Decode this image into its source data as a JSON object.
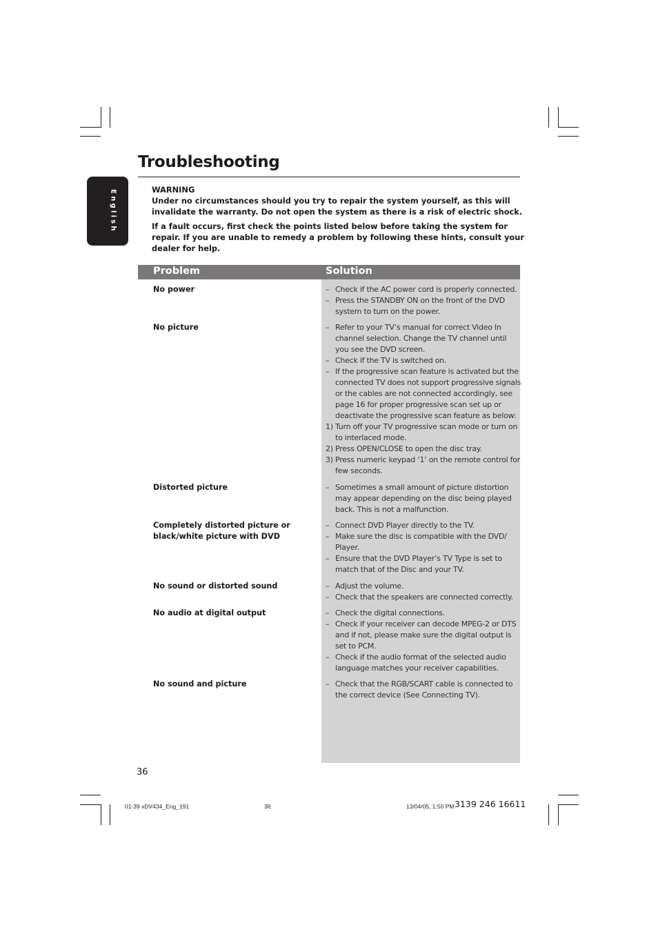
{
  "page": {
    "title": "Troubleshooting",
    "language_tab": "English",
    "warning": {
      "heading": "WARNING",
      "text": "Under no circumstances should you try to repair the system yourself, as this will invalidate the warranty.  Do not open the system as there is a risk of electric shock.",
      "advice": "If a fault occurs, first check the points listed below before taking the system for repair. If you are unable to remedy a problem by following these hints, consult your dealer for help."
    },
    "table": {
      "headers": {
        "problem": "Problem",
        "solution": "Solution"
      },
      "rows": [
        {
          "problem": "No power",
          "solutions": [
            {
              "marker": "–",
              "text": "Check if the AC power cord is properly connected."
            },
            {
              "marker": "–",
              "text": "Press the STANDBY ON on the front of the DVD system to turn on the power."
            }
          ]
        },
        {
          "problem": "No picture",
          "solutions": [
            {
              "marker": "–",
              "text": "Refer to your TV’s manual for correct Video In channel selection.  Change the TV channel until you see the DVD screen."
            },
            {
              "marker": "–",
              "text": "Check if the TV is switched on."
            },
            {
              "marker": "–",
              "text": "If the progressive scan feature is activated but the connected TV does not support progressive signals or the cables are not connected accordingly, see page 16 for proper progressive scan set up or deactivate the progressive scan feature as below:"
            },
            {
              "marker": "1)",
              "text": "Turn off your TV progressive scan mode or turn on to interlaced mode."
            },
            {
              "marker": "2)",
              "text": "Press OPEN/CLOSE to open the disc tray."
            },
            {
              "marker": "3)",
              "text": "Press numeric keypad ‘1’ on the remote control for few seconds."
            }
          ]
        },
        {
          "problem": "Distorted picture",
          "solutions": [
            {
              "marker": "–",
              "text": "Sometimes a small amount of picture distortion may appear depending on the disc being played back. This is not a malfunction."
            }
          ]
        },
        {
          "problem": "Completely distorted picture or black/white picture with DVD",
          "solutions": [
            {
              "marker": "–",
              "text": "Connect DVD Player directly to the TV."
            },
            {
              "marker": "–",
              "text": "Make sure the disc is compatible with the DVD/ Player."
            },
            {
              "marker": "–",
              "text": "Ensure that the DVD Player’s TV Type is set to match that of the Disc and your TV."
            }
          ]
        },
        {
          "problem": "No sound or distorted sound",
          "solutions": [
            {
              "marker": "–",
              "text": "Adjust the volume."
            },
            {
              "marker": "–",
              "text": "Check that the speakers are connected correctly."
            }
          ]
        },
        {
          "problem": "No audio at digital output",
          "solutions": [
            {
              "marker": "–",
              "text": "Check the digital connections."
            },
            {
              "marker": "–",
              "text": "Check if your receiver can decode MPEG-2 or DTS and if not, please make sure the digital output is set to PCM."
            },
            {
              "marker": "–",
              "text": "Check if the audio format of the selected audio language matches your receiver capabilities."
            }
          ]
        },
        {
          "problem": "No sound and picture",
          "solutions": [
            {
              "marker": "–",
              "text": "Check that the RGB/SCART cable is connected to the correct device (See Connecting TV)."
            }
          ]
        }
      ]
    },
    "page_number": "36",
    "footer": {
      "file": "01-39 xDV434_Eng_191",
      "page": "36",
      "timestamp": "13/04/05, 1:50 PM",
      "code": "3139 246 16611"
    },
    "colors": {
      "header_bar": "#7a7878",
      "solution_bg": "#d3d3d3",
      "tab_bg": "#231f20"
    }
  }
}
